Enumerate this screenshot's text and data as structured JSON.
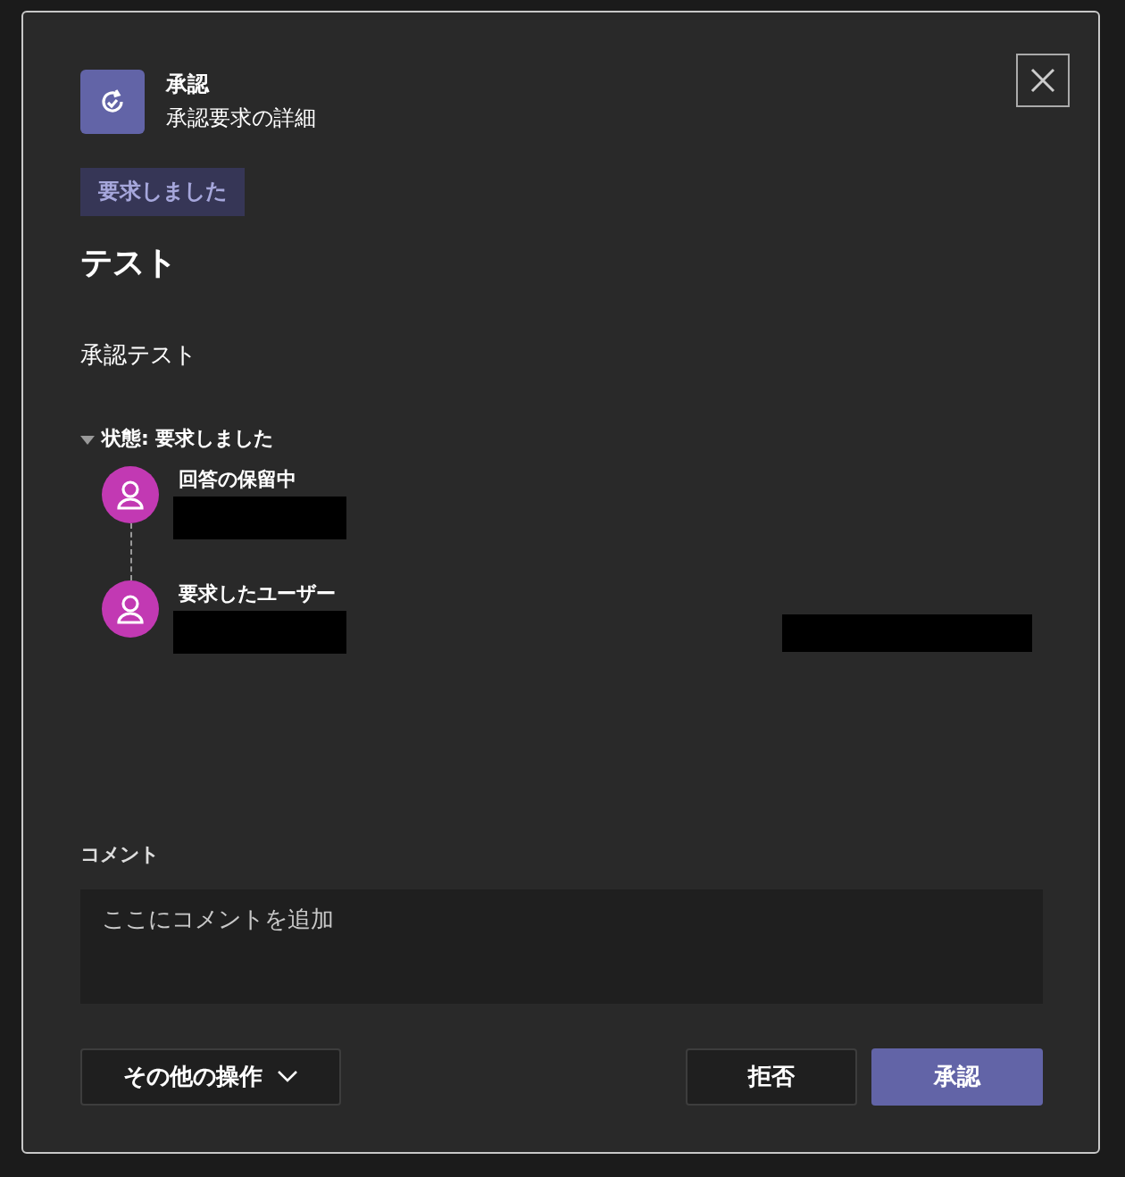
{
  "dialog": {
    "app_name": "承認",
    "subtitle": "承認要求の詳細",
    "status_badge": "要求しました",
    "title": "テスト",
    "description": "承認テスト"
  },
  "status_section": {
    "label": "状態: 要求しました",
    "expanded": true,
    "people": [
      {
        "role": "回答の保留中"
      },
      {
        "role": "要求したユーザー"
      }
    ]
  },
  "comment": {
    "label": "コメント",
    "placeholder": "ここにコメントを追加"
  },
  "buttons": [
    {
      "label": "その他の操作",
      "kind": "menu"
    },
    {
      "label": "拒否",
      "kind": "secondary"
    },
    {
      "label": "承認",
      "kind": "primary"
    }
  ]
}
